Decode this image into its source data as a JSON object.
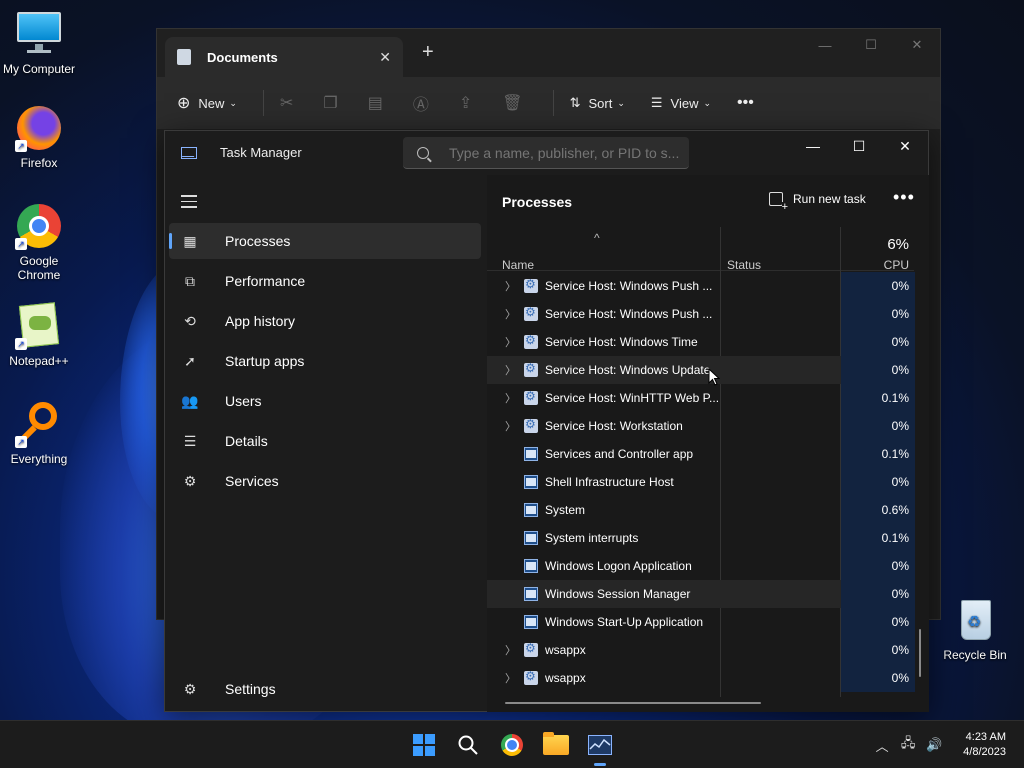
{
  "desktop": {
    "icons": [
      {
        "label": "My Computer"
      },
      {
        "label": "Firefox"
      },
      {
        "label": "Google Chrome"
      },
      {
        "label": "Notepad++"
      },
      {
        "label": "Everything"
      },
      {
        "label": "Recycle Bin"
      }
    ]
  },
  "explorer": {
    "tab_title": "Documents",
    "toolbar": {
      "new_label": "New",
      "sort_label": "Sort",
      "view_label": "View"
    }
  },
  "task_manager": {
    "title": "Task Manager",
    "search_placeholder": "Type a name, publisher, or PID to s...",
    "nav": [
      {
        "label": "Processes",
        "icon": "processes-icon"
      },
      {
        "label": "Performance",
        "icon": "performance-icon"
      },
      {
        "label": "App history",
        "icon": "app-history-icon"
      },
      {
        "label": "Startup apps",
        "icon": "startup-apps-icon"
      },
      {
        "label": "Users",
        "icon": "users-icon"
      },
      {
        "label": "Details",
        "icon": "details-icon"
      },
      {
        "label": "Services",
        "icon": "services-icon"
      }
    ],
    "settings_label": "Settings",
    "main": {
      "title": "Processes",
      "run_new_task_label": "Run new task",
      "columns": {
        "name": "Name",
        "status": "Status",
        "cpu_total": "6%",
        "cpu": "CPU"
      },
      "rows": [
        {
          "name": "Service Host: Windows Push ...",
          "cpu": "0%",
          "expandable": true,
          "icon": "gear"
        },
        {
          "name": "Service Host: Windows Push ...",
          "cpu": "0%",
          "expandable": true,
          "icon": "gear"
        },
        {
          "name": "Service Host: Windows Time",
          "cpu": "0%",
          "expandable": true,
          "icon": "gear"
        },
        {
          "name": "Service Host: Windows Update",
          "cpu": "0%",
          "expandable": true,
          "icon": "gear"
        },
        {
          "name": "Service Host: WinHTTP Web P...",
          "cpu": "0.1%",
          "expandable": true,
          "icon": "gear"
        },
        {
          "name": "Service Host: Workstation",
          "cpu": "0%",
          "expandable": true,
          "icon": "gear"
        },
        {
          "name": "Services and Controller app",
          "cpu": "0.1%",
          "expandable": false,
          "icon": "window"
        },
        {
          "name": "Shell Infrastructure Host",
          "cpu": "0%",
          "expandable": false,
          "icon": "window"
        },
        {
          "name": "System",
          "cpu": "0.6%",
          "expandable": false,
          "icon": "window"
        },
        {
          "name": "System interrupts",
          "cpu": "0.1%",
          "expandable": false,
          "icon": "window"
        },
        {
          "name": "Windows Logon Application",
          "cpu": "0%",
          "expandable": false,
          "icon": "window"
        },
        {
          "name": "Windows Session Manager",
          "cpu": "0%",
          "expandable": false,
          "icon": "window"
        },
        {
          "name": "Windows Start-Up Application",
          "cpu": "0%",
          "expandable": false,
          "icon": "window"
        },
        {
          "name": "wsappx",
          "cpu": "0%",
          "expandable": true,
          "icon": "gear"
        },
        {
          "name": "wsappx",
          "cpu": "0%",
          "expandable": true,
          "icon": "gear"
        }
      ]
    }
  },
  "taskbar": {
    "clock_time": "4:23 AM",
    "clock_date": "4/8/2023"
  }
}
